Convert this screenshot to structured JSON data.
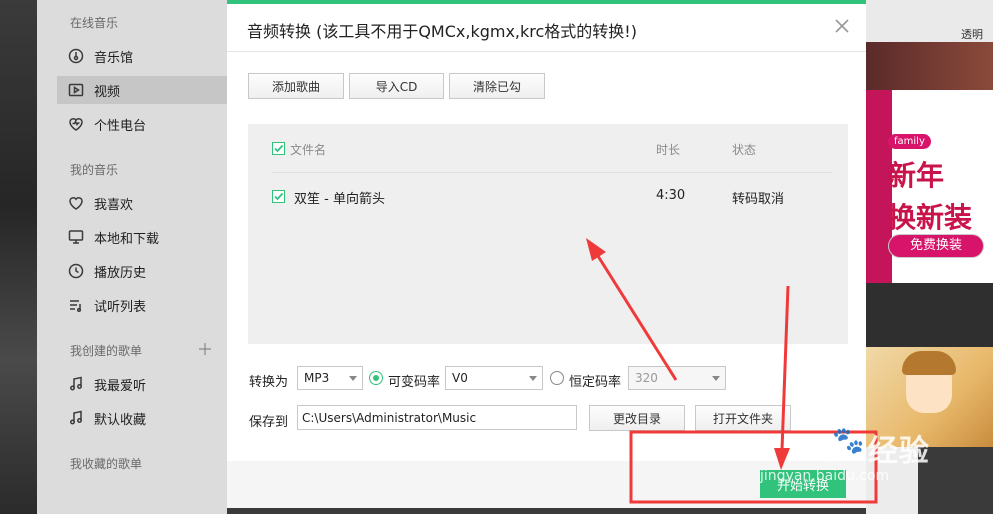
{
  "sidebar": {
    "section_online": "在线音乐",
    "section_mine": "我的音乐",
    "section_created": "我创建的歌单",
    "section_collected": "我收藏的歌单",
    "items": [
      {
        "label": "音乐馆",
        "icon": "music-hall-icon"
      },
      {
        "label": "视频",
        "icon": "video-icon"
      },
      {
        "label": "个性电台",
        "icon": "heart-radio-icon"
      },
      {
        "label": "我喜欢",
        "icon": "heart-icon"
      },
      {
        "label": "本地和下载",
        "icon": "monitor-icon"
      },
      {
        "label": "播放历史",
        "icon": "clock-icon"
      },
      {
        "label": "试听列表",
        "icon": "playlist-icon"
      },
      {
        "label": "我最爱听",
        "icon": "note-icon"
      },
      {
        "label": "默认收藏",
        "icon": "note-icon"
      }
    ]
  },
  "background": {
    "top_right_text": "透明",
    "promo_badge": "family",
    "promo_line1": "新年",
    "promo_line2": "换新装",
    "promo_button": "免费换装"
  },
  "dialog": {
    "title": "音频转换 (该工具不用于QMCx,kgmx,krc格式的转换!)",
    "buttons": {
      "add_song": "添加歌曲",
      "import_cd": "导入CD",
      "clear_checked": "清除已勾"
    },
    "table": {
      "headers": {
        "filename": "文件名",
        "duration": "时长",
        "status": "状态"
      },
      "rows": [
        {
          "filename": "双笙 - 单向箭头",
          "duration": "4:30",
          "status": "转码取消",
          "checked": true
        }
      ]
    },
    "convert": {
      "label": "转换为",
      "format": "MP3",
      "vbr_label": "可变码率",
      "vbr_value": "V0",
      "cbr_label": "恒定码率",
      "cbr_value": "320",
      "selected_mode": "vbr"
    },
    "save": {
      "label": "保存到",
      "path": "C:\\Users\\Administrator\\Music",
      "change_dir": "更改目录",
      "open_folder": "打开文件夹"
    },
    "start_button": "开始转换"
  },
  "watermark": {
    "brand": "Bai  经验",
    "url": "jingyan.baidu.com"
  },
  "colors": {
    "accent": "#31c27c",
    "annotation": "#f03a3a"
  }
}
